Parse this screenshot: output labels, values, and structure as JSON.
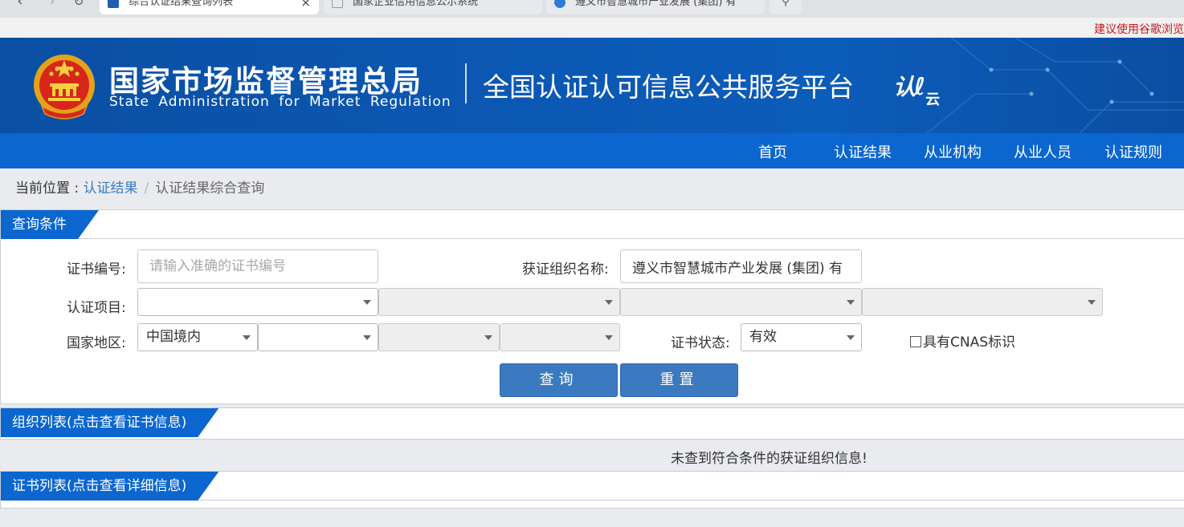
{
  "browser": {
    "tabs": [
      {
        "title": "综合认证结果查询列表"
      },
      {
        "title": "国家企业信用信息公示系统"
      },
      {
        "title": "遵义市智慧城市产业发展 (集团) 有"
      }
    ]
  },
  "notice": "建议使用谷歌浏览",
  "header": {
    "agency_cn": "国家市场监督管理总局",
    "agency_en": "State Administration  for  Market Regulation",
    "platform_title": "全国认证认可信息公共服务平台",
    "cloud_logo": "认",
    "cloud_logo_suffix": "云"
  },
  "nav": {
    "items": [
      {
        "label": "首页"
      },
      {
        "label": "认证结果"
      },
      {
        "label": "从业机构"
      },
      {
        "label": "从业人员"
      },
      {
        "label": "认证规则"
      }
    ]
  },
  "breadcrumb": {
    "prefix": "当前位置 : ",
    "link": "认证结果",
    "separator": "/",
    "current": "认证结果综合查询"
  },
  "query": {
    "panel_title": "查询条件",
    "cert_no_label": "证书编号:",
    "cert_no_placeholder": "请输入准确的证书编号",
    "cert_no_value": "",
    "org_name_label": "获证组织名称:",
    "org_name_value": "遵义市智慧城市产业发展 (集团) 有",
    "project_label": "认证项目:",
    "project_select": "",
    "region_label": "国家地区:",
    "region_select": "中国境内",
    "province_select": "",
    "status_label": "证书状态:",
    "status_select": "有效",
    "cnas_label": "具有CNAS标识",
    "cnas_checked": false,
    "search_button": "查询",
    "reset_button": "重置"
  },
  "org_list": {
    "panel_title": "组织列表(点击查看证书信息)",
    "empty_message": "未查到符合条件的获证组织信息!"
  },
  "cert_list": {
    "panel_title": "证书列表(点击查看详细信息)"
  },
  "colors": {
    "nav_blue": "#0b66cf",
    "banner_blue": "#0b58b4",
    "button_blue": "#3b7ac0",
    "notice_red": "#c8161d",
    "link_blue": "#3a7cc4"
  }
}
